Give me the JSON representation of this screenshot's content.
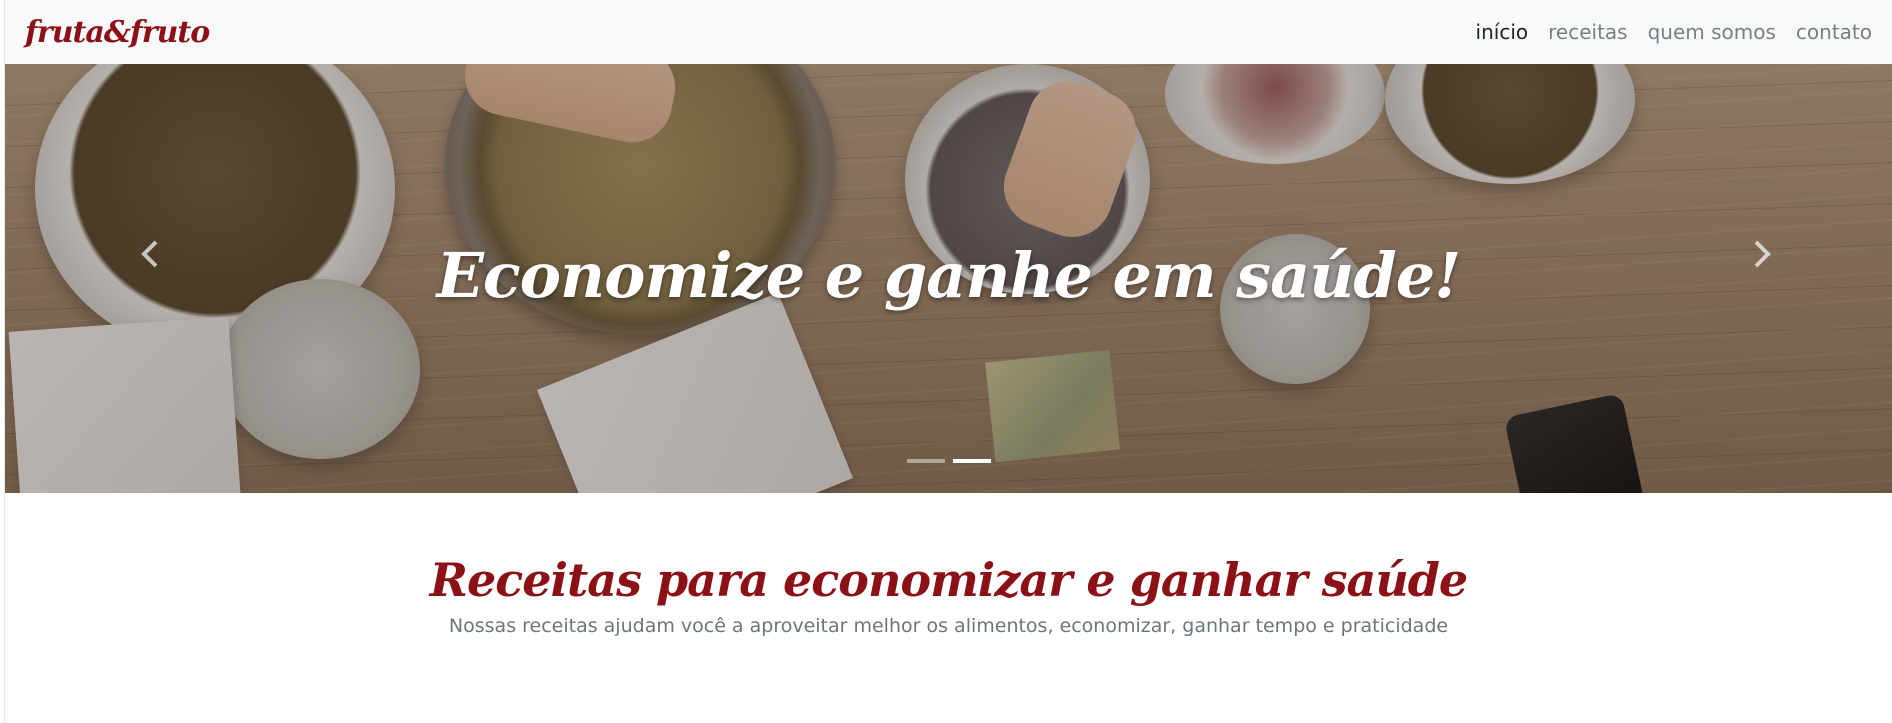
{
  "brand": {
    "name": "fruta&fruto",
    "color": "#8b1116"
  },
  "nav": {
    "items": [
      {
        "label": "início",
        "active": true
      },
      {
        "label": "receitas",
        "active": false
      },
      {
        "label": "quem somos",
        "active": false
      },
      {
        "label": "contato",
        "active": false
      }
    ]
  },
  "hero": {
    "caption": "Economize e ganhe em saúde!",
    "prev_icon": "chevron-left-icon",
    "next_icon": "chevron-right-icon",
    "slides_count": 2,
    "active_slide": 2
  },
  "section": {
    "title": "Receitas para economizar e ganhar saúde",
    "subtitle": "Nossas receitas ajudam você a aproveitar melhor os alimentos, economizar, ganhar tempo e praticidade"
  },
  "colors": {
    "accent": "#8b1116",
    "navbar_bg": "#f8f9fa",
    "muted_text": "#6c757d"
  }
}
